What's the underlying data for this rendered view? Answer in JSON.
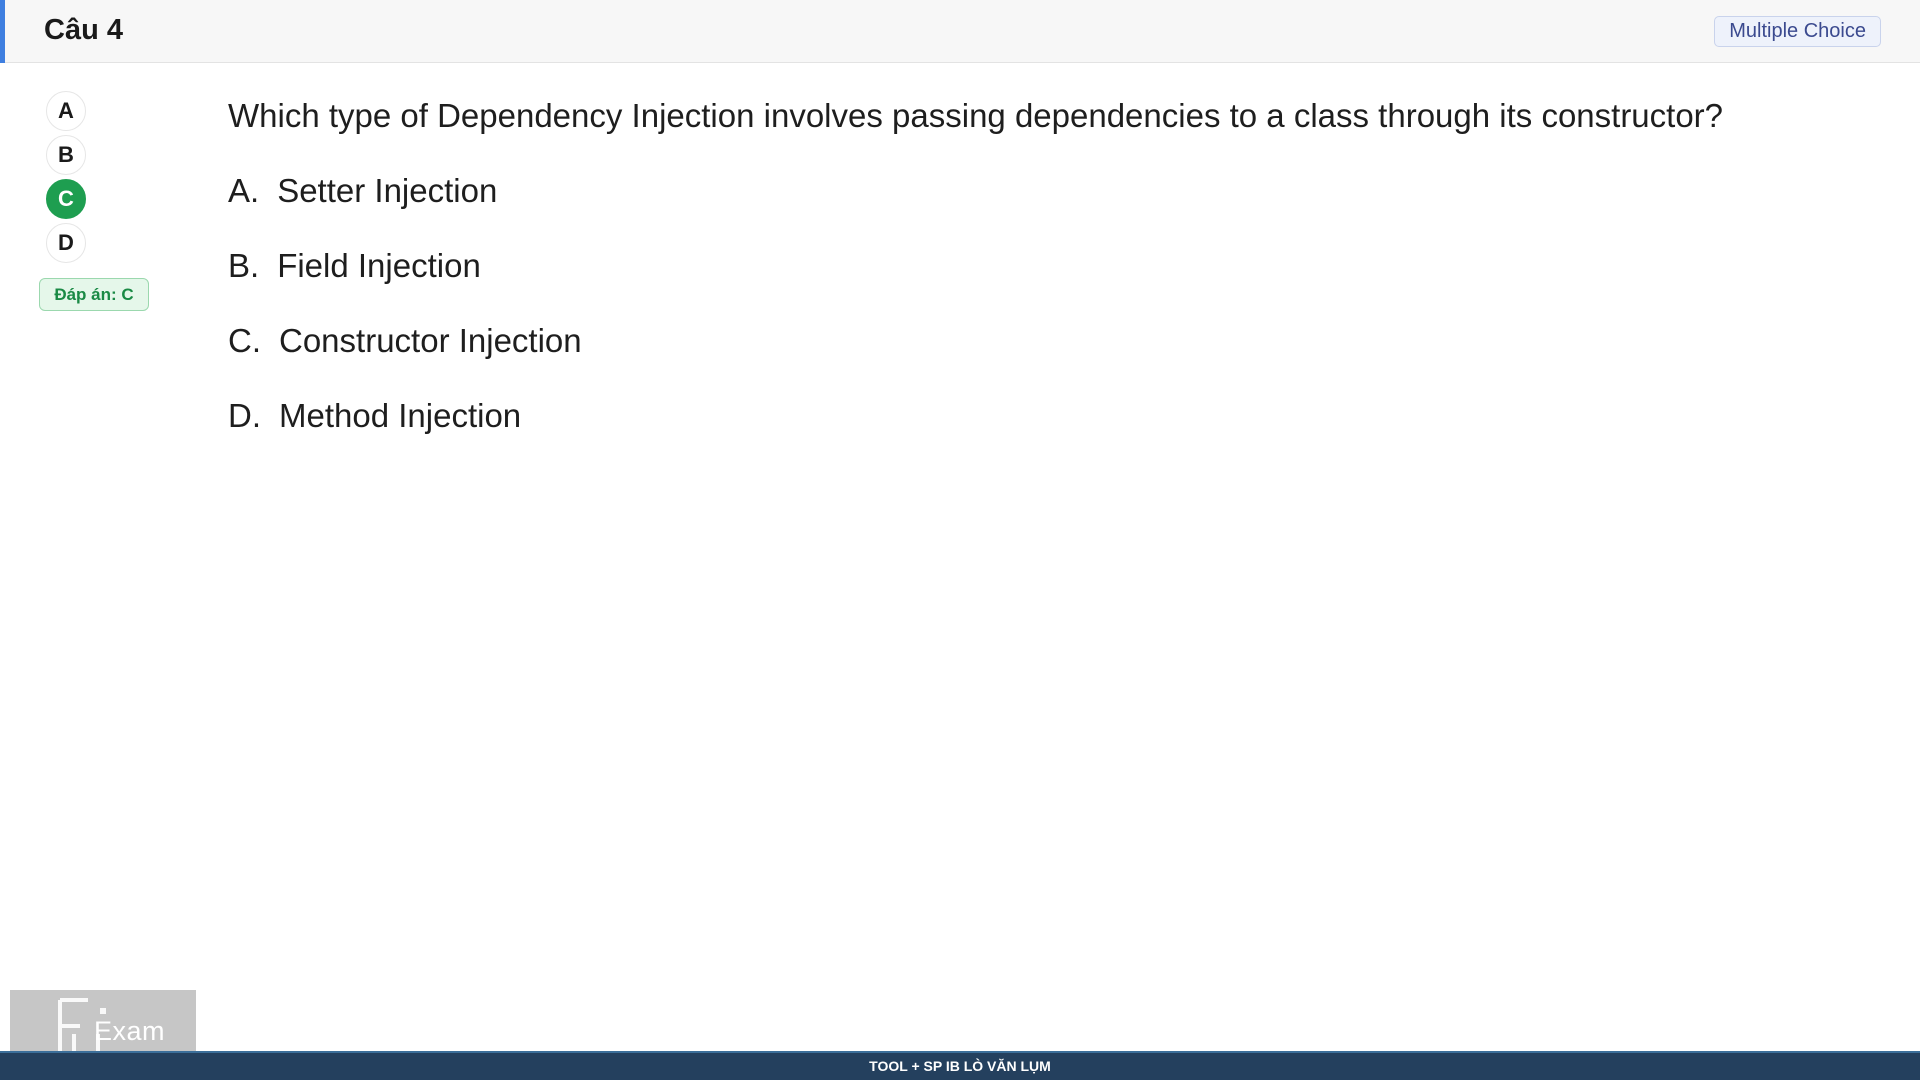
{
  "header": {
    "title": "Câu 4",
    "type_badge": "Multiple Choice"
  },
  "choices": [
    {
      "label": "A",
      "selected": false
    },
    {
      "label": "B",
      "selected": false
    },
    {
      "label": "C",
      "selected": true
    },
    {
      "label": "D",
      "selected": false
    }
  ],
  "answer_badge": "Đáp án: C",
  "question": {
    "text": "Which type of Dependency Injection involves passing dependencies to a class through its constructor?",
    "options": [
      {
        "letter": "A.",
        "text": "Setter Injection"
      },
      {
        "letter": "B.",
        "text": "Field Injection"
      },
      {
        "letter": "C.",
        "text": "Constructor Injection"
      },
      {
        "letter": "D.",
        "text": "Method Injection"
      }
    ]
  },
  "watermark": {
    "text": "Exam",
    "logo_icon": "fu-logo-icon"
  },
  "footer": {
    "text": "TOOL + SP IB LÒ VĂN LỤM"
  },
  "colors": {
    "accent_blue": "#3f7fe0",
    "selected_green": "#1e9e50",
    "footer_bg": "#24405e"
  }
}
